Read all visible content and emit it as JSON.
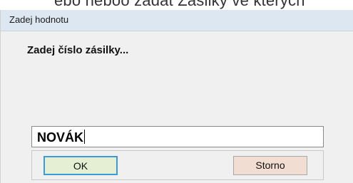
{
  "background_text": "ebo neboo zadat Zásilky ve kterých",
  "dialog": {
    "title": "Zadej hodnotu",
    "prompt": "Zadej číslo zásilky...",
    "input": {
      "value": "NOVÁK"
    },
    "buttons": {
      "ok_label": "OK",
      "cancel_label": "Storno"
    }
  },
  "colors": {
    "titlebar": "#dde7f2",
    "window_bg": "#f0f0f0",
    "ok_button_bg": "#e5efd4",
    "ok_button_focus_border": "#3c9ad6",
    "cancel_button_bg": "#f1ddd2"
  }
}
